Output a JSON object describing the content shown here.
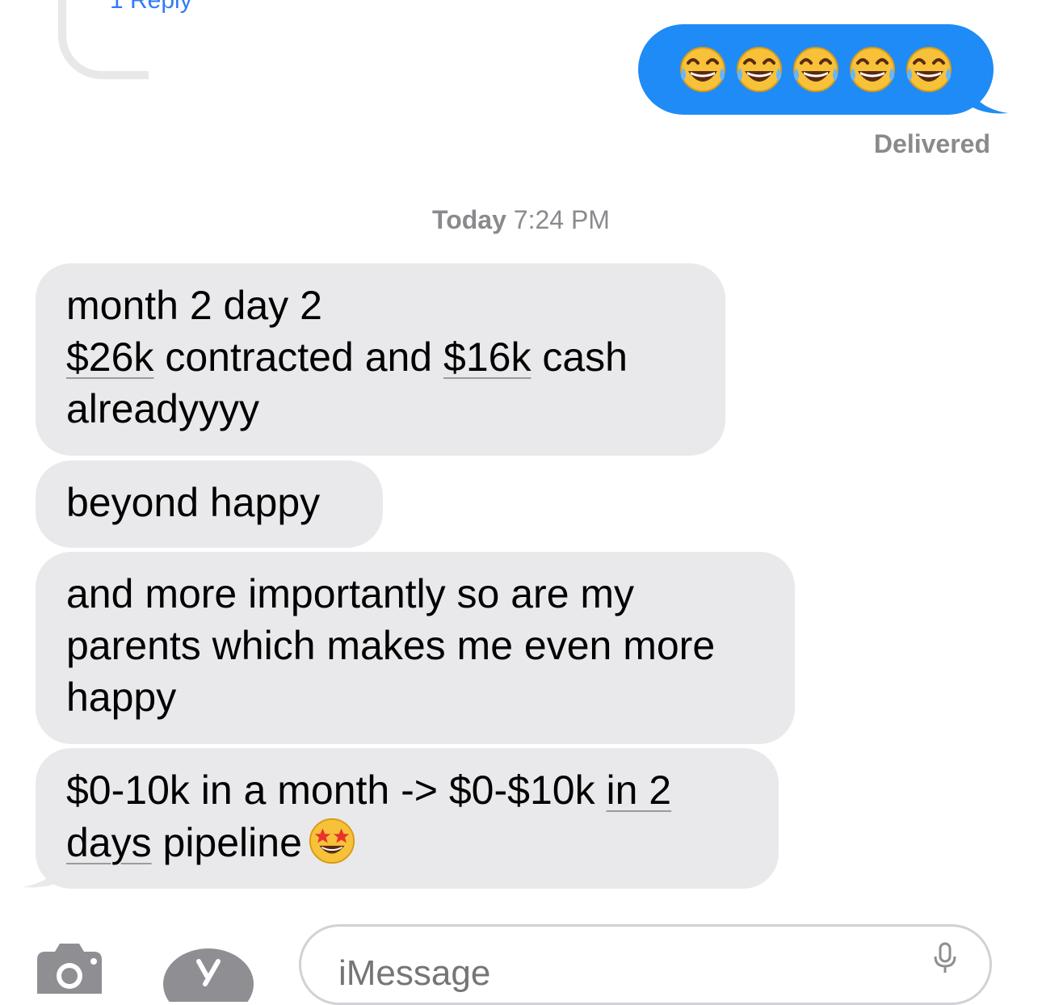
{
  "thread": {
    "reply_link": "1 Reply"
  },
  "outgoing": {
    "emoji": [
      "😂",
      "😂",
      "😂",
      "😂",
      "😂"
    ],
    "emoji_name": "face-with-tears-of-joy",
    "bubble_color": "#1f8bf6",
    "status": "Delivered"
  },
  "timestamp": {
    "day": "Today",
    "time": "7:24 PM"
  },
  "incoming": {
    "bubble_color": "#e9e9eb",
    "messages": [
      {
        "lines": [
          "month 2 day 2",
          "$26k contracted and $16k cash",
          "alreadyyyy"
        ],
        "underlined": [
          "$26k",
          "$16k"
        ]
      },
      {
        "lines": [
          "beyond happy"
        ]
      },
      {
        "lines": [
          "and more importantly so are my",
          "parents which makes me even more",
          "happy"
        ]
      },
      {
        "lines": [
          "$0-10k in a month -> $0-$10k in 2",
          "days pipeline"
        ],
        "underlined": [
          "in 2",
          "days"
        ],
        "trailing_emoji": "star-struck"
      }
    ]
  },
  "composer": {
    "placeholder": "iMessage",
    "icons": [
      "camera-icon",
      "app-store-icon",
      "microphone-icon"
    ]
  }
}
